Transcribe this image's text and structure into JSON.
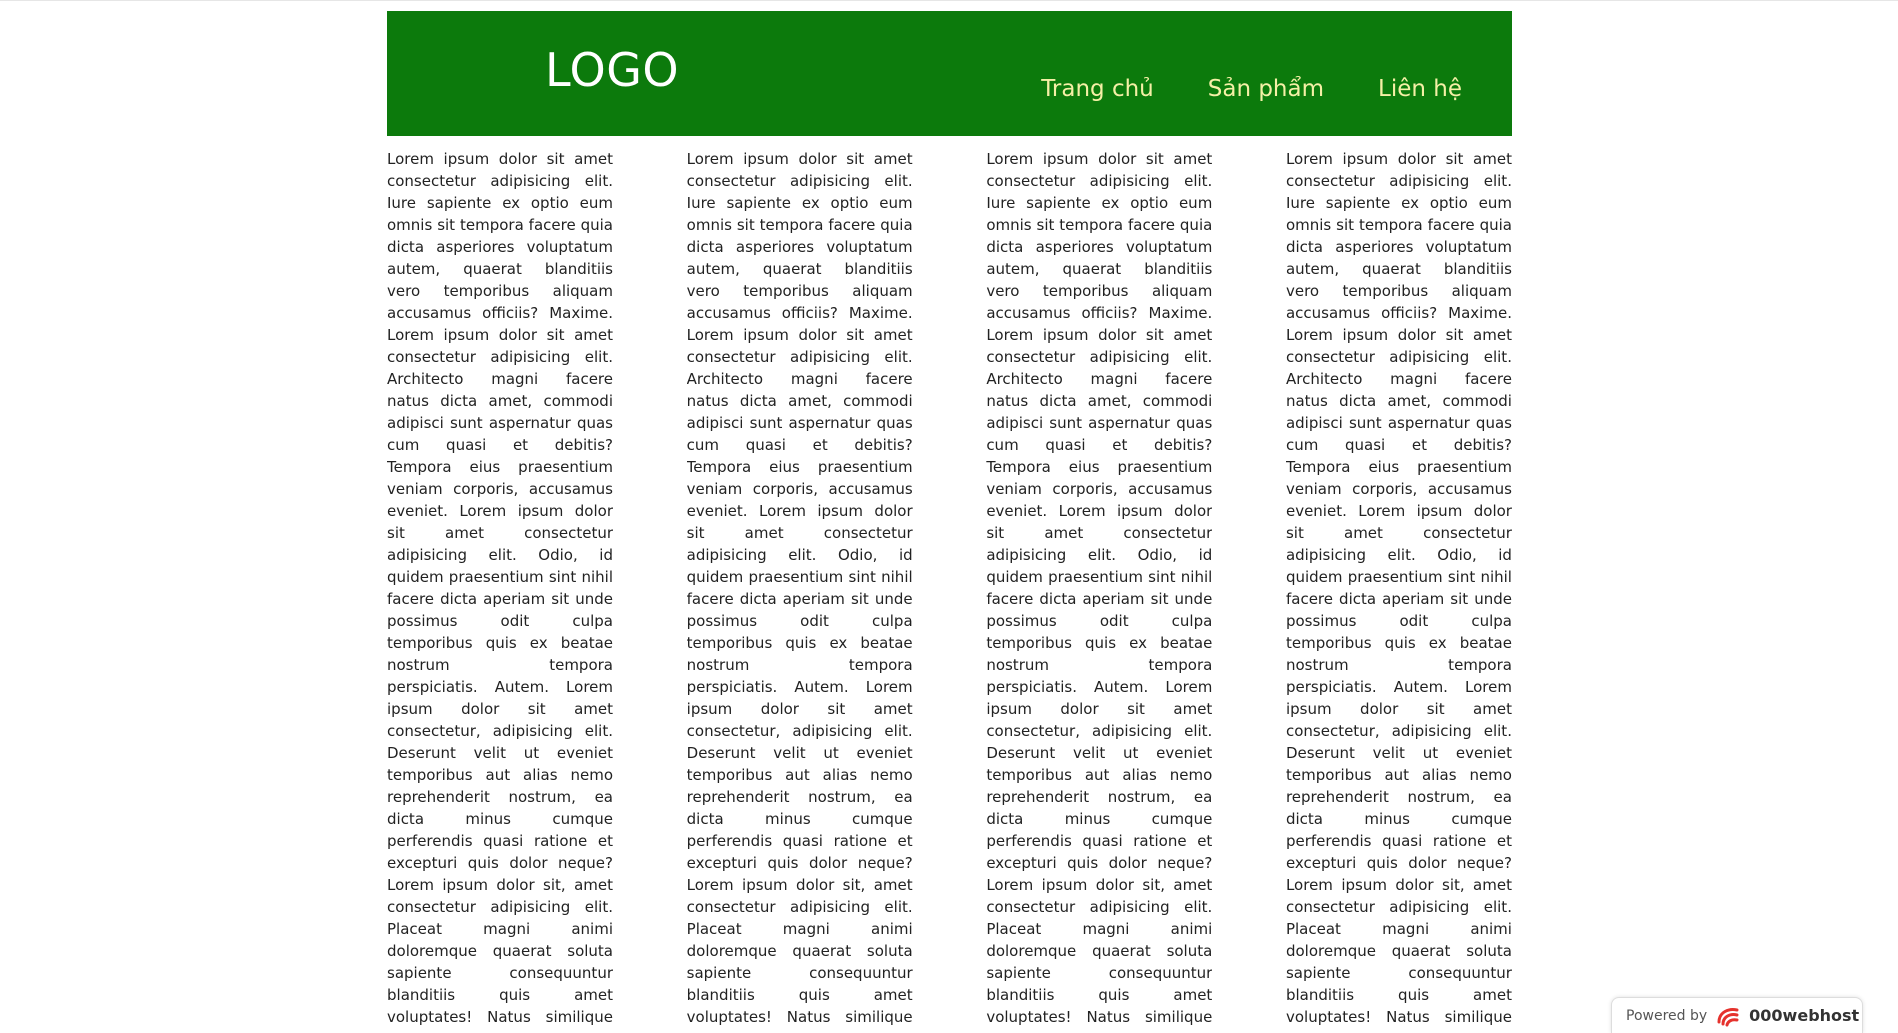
{
  "header": {
    "logo": "LOGO",
    "nav": [
      {
        "label": "Trang chủ"
      },
      {
        "label": "Sản phẩm"
      },
      {
        "label": "Liên hệ"
      }
    ]
  },
  "columns": [
    {
      "text": "Lorem ipsum dolor sit amet consectetur adipisicing elit. Iure sapiente ex optio eum omnis sit tempora facere quia dicta asperiores voluptatum autem, quaerat blanditiis vero temporibus aliquam accusamus officiis? Maxime. Lorem ipsum dolor sit amet consectetur adipisicing elit. Architecto magni facere natus dicta amet, commodi adipisci sunt aspernatur quas cum quasi et debitis? Tempora eius praesentium veniam corporis, accusamus eveniet. Lorem ipsum dolor sit amet consectetur adipisicing elit. Odio, id quidem praesentium sint nihil facere dicta aperiam sit unde possimus odit culpa temporibus quis ex beatae nostrum tempora perspiciatis. Autem. Lorem ipsum dolor sit amet consectetur, adipisicing elit. Deserunt velit ut eveniet temporibus aut alias nemo reprehenderit nostrum, ea dicta minus cumque perferendis quasi ratione et excepturi quis dolor neque? Lorem ipsum dolor sit, amet consectetur adipisicing elit. Placeat magni animi doloremque quaerat soluta sapiente consequuntur blanditiis quis amet voluptates! Natus similique aliquam voluptas nemo omnis laudantium maiores iste"
    },
    {
      "text": "Lorem ipsum dolor sit amet consectetur adipisicing elit. Iure sapiente ex optio eum omnis sit tempora facere quia dicta asperiores voluptatum autem, quaerat blanditiis vero temporibus aliquam accusamus officiis? Maxime. Lorem ipsum dolor sit amet consectetur adipisicing elit. Architecto magni facere natus dicta amet, commodi adipisci sunt aspernatur quas cum quasi et debitis? Tempora eius praesentium veniam corporis, accusamus eveniet. Lorem ipsum dolor sit amet consectetur adipisicing elit. Odio, id quidem praesentium sint nihil facere dicta aperiam sit unde possimus odit culpa temporibus quis ex beatae nostrum tempora perspiciatis. Autem. Lorem ipsum dolor sit amet consectetur, adipisicing elit. Deserunt velit ut eveniet temporibus aut alias nemo reprehenderit nostrum, ea dicta minus cumque perferendis quasi ratione et excepturi quis dolor neque? Lorem ipsum dolor sit, amet consectetur adipisicing elit. Placeat magni animi doloremque quaerat soluta sapiente consequuntur blanditiis quis amet voluptates! Natus similique aliquam voluptas nemo omnis laudantium maiores iste"
    },
    {
      "text": "Lorem ipsum dolor sit amet consectetur adipisicing elit. Iure sapiente ex optio eum omnis sit tempora facere quia dicta asperiores voluptatum autem, quaerat blanditiis vero temporibus aliquam accusamus officiis? Maxime. Lorem ipsum dolor sit amet consectetur adipisicing elit. Architecto magni facere natus dicta amet, commodi adipisci sunt aspernatur quas cum quasi et debitis? Tempora eius praesentium veniam corporis, accusamus eveniet. Lorem ipsum dolor sit amet consectetur adipisicing elit. Odio, id quidem praesentium sint nihil facere dicta aperiam sit unde possimus odit culpa temporibus quis ex beatae nostrum tempora perspiciatis. Autem. Lorem ipsum dolor sit amet consectetur, adipisicing elit. Deserunt velit ut eveniet temporibus aut alias nemo reprehenderit nostrum, ea dicta minus cumque perferendis quasi ratione et excepturi quis dolor neque? Lorem ipsum dolor sit, amet consectetur adipisicing elit. Placeat magni animi doloremque quaerat soluta sapiente consequuntur blanditiis quis amet voluptates! Natus similique aliquam voluptas nemo omnis laudantium maiores iste"
    },
    {
      "text": "Lorem ipsum dolor sit amet consectetur adipisicing elit. Iure sapiente ex optio eum omnis sit tempora facere quia dicta asperiores voluptatum autem, quaerat blanditiis vero temporibus aliquam accusamus officiis? Maxime. Lorem ipsum dolor sit amet consectetur adipisicing elit. Architecto magni facere natus dicta amet, commodi adipisci sunt aspernatur quas cum quasi et debitis? Tempora eius praesentium veniam corporis, accusamus eveniet. Lorem ipsum dolor sit amet consectetur adipisicing elit. Odio, id quidem praesentium sint nihil facere dicta aperiam sit unde possimus odit culpa temporibus quis ex beatae nostrum tempora perspiciatis. Autem. Lorem ipsum dolor sit amet consectetur, adipisicing elit. Deserunt velit ut eveniet temporibus aut alias nemo reprehenderit nostrum, ea dicta minus cumque perferendis quasi ratione et excepturi quis dolor neque? Lorem ipsum dolor sit, amet consectetur adipisicing elit. Placeat magni animi doloremque quaerat soluta sapiente consequuntur blanditiis quis amet voluptates! Natus similique aliquam voluptas nemo omnis laudantium maiores iste"
    }
  ],
  "badge": {
    "powered_by": "Powered by",
    "brand": "000webhost",
    "icon": "000webhost-logo-icon"
  },
  "colors": {
    "header_bg": "#0c7a0c",
    "logo_text": "#ffffff",
    "nav_text": "#f5f0a6"
  }
}
